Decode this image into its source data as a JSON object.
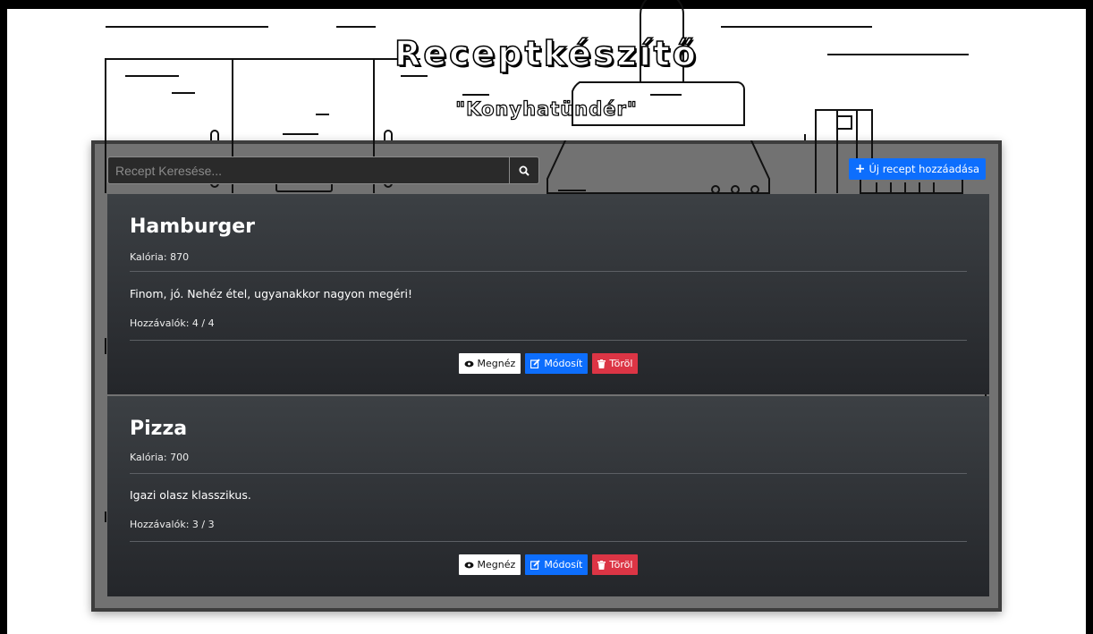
{
  "app": {
    "title": "Receptkészítő",
    "subtitle": "\"Konyhatündér\""
  },
  "search": {
    "placeholder": "Recept Keresése..."
  },
  "toolbar": {
    "add_label": "Új recept hozzáadása"
  },
  "recipes": [
    {
      "name": "Hamburger",
      "calories": "Kalória: 870",
      "description": "Finom, jó. Nehéz étel, ugyanakkor nagyon megéri!",
      "ingredients": "Hozzávalók: 4 / 4"
    },
    {
      "name": "Pizza",
      "calories": "Kalória: 700",
      "description": "Igazi olasz klasszikus.",
      "ingredients": "Hozzávalók: 3 / 3"
    }
  ],
  "actions": {
    "view": "Megnéz",
    "edit": "Módosít",
    "delete": "Töröl"
  },
  "colors": {
    "primary": "#0d6efd",
    "danger": "#dc3545",
    "card": "#2f3236"
  }
}
